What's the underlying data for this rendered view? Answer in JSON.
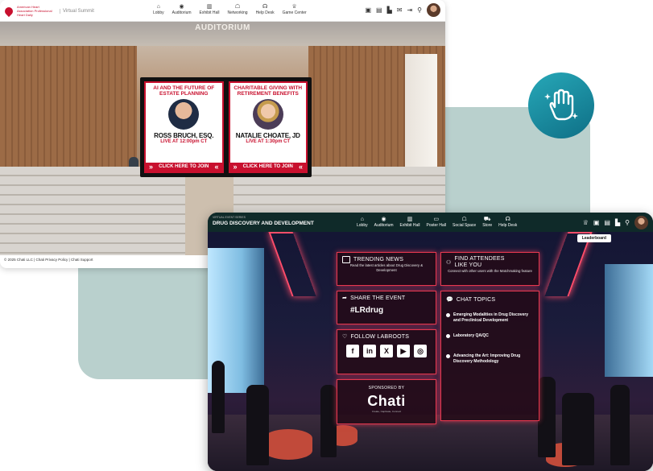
{
  "window1": {
    "logo_text": "American Heart Association Professional Heart Daily",
    "virtual_summit": "Virtual Summit",
    "nav": [
      {
        "label": "Lobby",
        "icon": "home-icon"
      },
      {
        "label": "Auditorium",
        "icon": "auditorium-icon"
      },
      {
        "label": "Exhibit Hall",
        "icon": "exhibit-hall-icon"
      },
      {
        "label": "Networking",
        "icon": "networking-icon"
      },
      {
        "label": "Help Desk",
        "icon": "help-desk-icon"
      },
      {
        "label": "Game Center",
        "icon": "trophy-icon"
      }
    ],
    "room_title": "AUDITORIUM",
    "sessions": [
      {
        "title": "AI AND THE FUTURE OF ESTATE PLANNING",
        "speaker": "ROSS BRUCH, ESQ.",
        "time": "LIVE AT 12:00pm CT",
        "cta": "CLICK HERE TO JOIN"
      },
      {
        "title": "CHARITABLE GIVING WITH RETIREMENT BENEFITS",
        "speaker": "NATALIE CHOATE, JD",
        "time": "LIVE AT 1:30pm CT",
        "cta": "CLICK HERE TO JOIN"
      }
    ],
    "footer": "© 2025 Chati LLC | Chati Privacy Policy | Chati Support"
  },
  "window2": {
    "event_series": "VIRTUAL EVENT SERIES",
    "event_title": "DRUG DISCOVERY AND DEVELOPMENT",
    "nav": [
      {
        "label": "Lobby",
        "icon": "home-icon"
      },
      {
        "label": "Auditorium",
        "icon": "auditorium-icon"
      },
      {
        "label": "Exhibit Hall",
        "icon": "exhibit-hall-icon"
      },
      {
        "label": "Poster Hall",
        "icon": "poster-hall-icon"
      },
      {
        "label": "Social Space",
        "icon": "social-space-icon"
      },
      {
        "label": "Store",
        "icon": "cart-icon"
      },
      {
        "label": "Help Desk",
        "icon": "help-desk-icon"
      }
    ],
    "leaderboard": "Leaderboard",
    "trending": {
      "title": "TRENDING NEWS",
      "sub": "Read the latest articles about Drug Discovery & Development"
    },
    "find": {
      "title": "FIND ATTENDEES LIKE YOU",
      "sub": "Connect with other users with the Matchmaking feature"
    },
    "share": {
      "title": "SHARE THE EVENT",
      "hashtag": "#LRdrug"
    },
    "follow": {
      "title": "FOLLOW LABROOTS"
    },
    "sponsor": {
      "label": "SPONSORED BY",
      "name": "Chati",
      "tagline": "Create, Captivate, Connect"
    },
    "topics": {
      "title": "CHAT TOPICS",
      "items": [
        "Emerging Modalities in Drug Discovery and Preclinical Development",
        "Laboratory QA/QC",
        "Advancing the Art: Improving Drug Discovery Methodology"
      ]
    }
  },
  "colors": {
    "accent_red": "#c8102e",
    "neon": "#e6384f",
    "teal_panel": "#b9d0cd",
    "badge": "#1a8ea3"
  }
}
